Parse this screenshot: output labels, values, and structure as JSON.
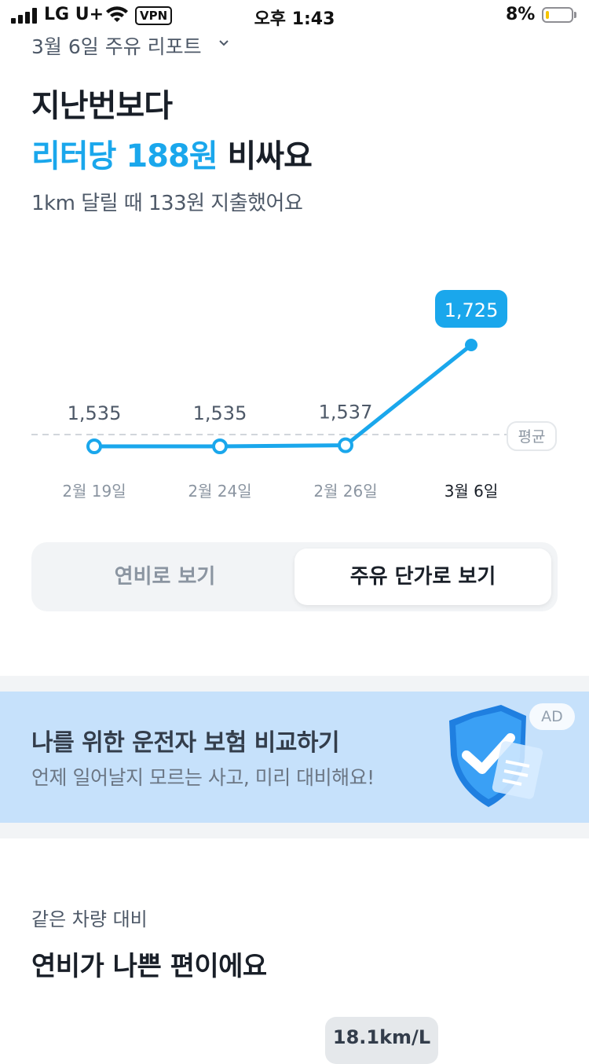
{
  "status_bar": {
    "carrier": "LG U+",
    "vpn": "VPN",
    "time": "오후 1:43",
    "battery": "8%"
  },
  "header": {
    "report_title": "3월 6일 주유 리포트"
  },
  "summary": {
    "line1": "지난번보다",
    "line2_highlight": "리터당 188원",
    "line2_rest": " 비싸요",
    "subline": "1km 달릴 때 133원 지출했어요"
  },
  "chart_data": {
    "type": "line",
    "categories": [
      "2월 19일",
      "2월 24일",
      "2월 26일",
      "3월 6일"
    ],
    "values": [
      1535,
      1535,
      1537,
      1725
    ],
    "value_labels": [
      "1,535",
      "1,535",
      "1,537",
      "1,725"
    ],
    "highlight_index": 3,
    "average_label": "평균",
    "colors": {
      "line": "#1aa7ec",
      "average": "#d1d6db"
    }
  },
  "toggle": {
    "option1": "연비로 보기",
    "option2": "주유 단가로 보기",
    "selected": 1
  },
  "ad": {
    "title": "나를 위한 운전자 보험 비교하기",
    "subtitle": "언제 일어날지 모르는 사고, 미리 대비해요!",
    "badge": "AD"
  },
  "comparison": {
    "label": "같은 차량 대비",
    "title": "연비가 나쁜 편이에요",
    "efficiency": "18.1km/L"
  }
}
